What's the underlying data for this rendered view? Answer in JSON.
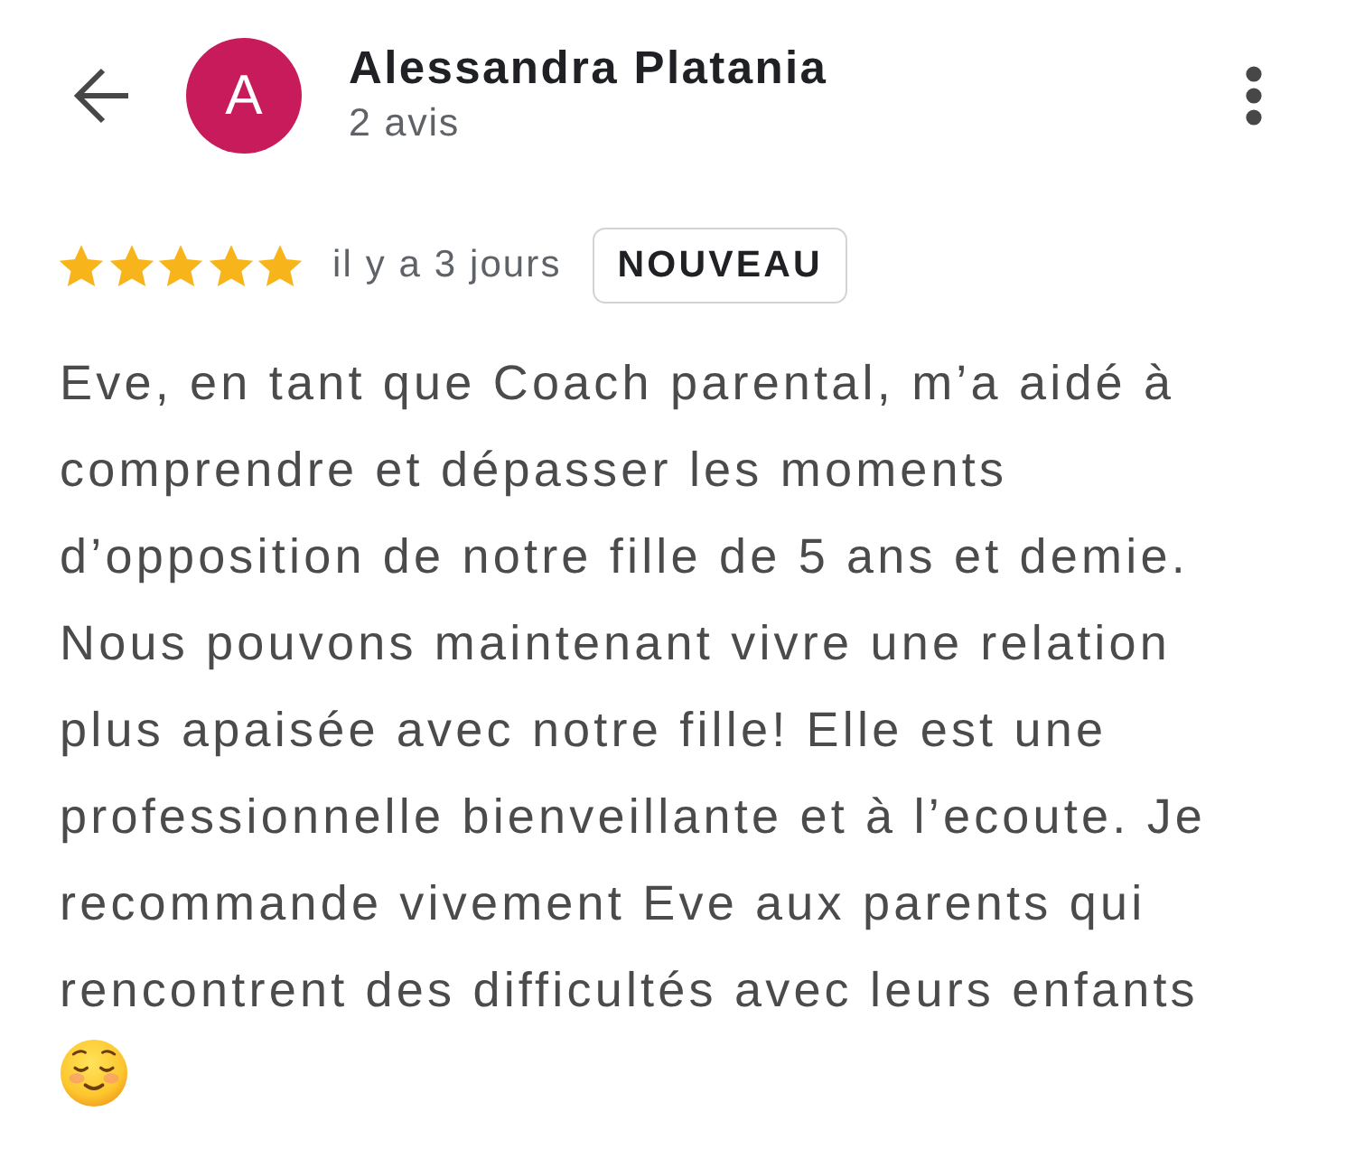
{
  "reviewer": {
    "avatar_letter": "A",
    "name": "Alessandra Platania",
    "review_count": "2 avis"
  },
  "review": {
    "stars": 5,
    "time": "il y a 3 jours",
    "badge": "NOUVEAU",
    "text": "Eve, en tant que Coach parental, m’a aidé à\ncomprendre et dépasser les moments\nd’opposition de notre fille de 5 ans et demie.\nNous pouvons maintenant vivre une relation\nplus apaisée avec notre fille! Elle est une\nprofessionnelle bienveillante et à l’ecoute. Je\nrecommande vivement Eve aux parents qui\nrencontrent des difficultés avec leurs enfants"
  }
}
